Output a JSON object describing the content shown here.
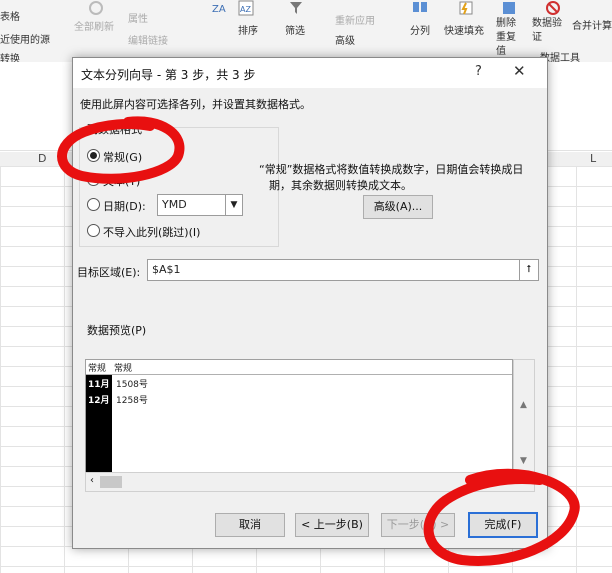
{
  "ribbon": {
    "left_items": [
      "表格",
      "近使用的源",
      "转换"
    ],
    "refresh_all": "全部刷新",
    "properties": "属性",
    "edit_links": "编辑链接",
    "sort": "排序",
    "filter": "筛选",
    "reapply": "重新应用",
    "advanced": "高级",
    "split": "分列",
    "flash_fill": "快速填充",
    "remove_dup": "删除重复值",
    "data_validation": "数据验证",
    "consolidate": "合并计算",
    "data_tools": "数据工具"
  },
  "sheet": {
    "col_d": "D",
    "col_l": "L"
  },
  "dialog": {
    "title": "文本分列向导 - 第 3 步，共 3 步",
    "help": "?",
    "close": "✕",
    "instruction": "使用此屏内容可选择各列，并设置其数据格式。",
    "group_label": "列数据格式",
    "opt_general": "常规(G)",
    "opt_text": "文本(T)",
    "opt_date": "日期(D):",
    "date_value": "YMD",
    "opt_skip": "不导入此列(跳过)(I)",
    "desc_line1": "“常规”数据格式将数值转换成数字，日期值会转换成日",
    "desc_line2": "期，其余数据则转换成文本。",
    "advanced_btn": "高级(A)...",
    "dest_label": "目标区域(E):",
    "dest_value": "$A$1",
    "preview_label": "数据预览(P)",
    "preview_header": [
      "常规",
      "常规"
    ],
    "preview_rows": [
      [
        "11月",
        "1508号"
      ],
      [
        "12月",
        "1258号"
      ]
    ],
    "cancel": "取消",
    "back": "< 上一步(B)",
    "next": "下一步(N) >",
    "finish": "完成(F)"
  },
  "colors": {
    "annotation": "#e81010",
    "focus": "#2a6fd6"
  }
}
